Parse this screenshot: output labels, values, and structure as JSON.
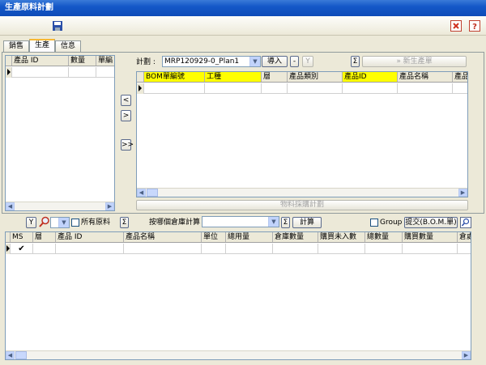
{
  "window": {
    "title": "生產原料計劃"
  },
  "tabs": [
    {
      "label": "銷售"
    },
    {
      "label": "生產"
    },
    {
      "label": "信息"
    }
  ],
  "left_grid": {
    "columns": [
      "產品 ID",
      "數量",
      "單編"
    ]
  },
  "plan": {
    "label": "計劃 :",
    "value": "MRP120929-0_Plan1",
    "import_label": "導入",
    "minus_label": "-",
    "filter_icon_label": "Y",
    "sigma_label": "Σ",
    "new_order_label": "» 新生產單"
  },
  "move_buttons": {
    "left": "<",
    "right": ">",
    "all": ">>"
  },
  "bom_grid": {
    "columns": [
      "BOM單編號",
      "工種",
      "層",
      "產品類別",
      "產品ID",
      "產品名稱",
      "產品"
    ]
  },
  "material_plan_label": "物料採購計劃",
  "controls": {
    "filter_label": "Y",
    "all_materials_label": "所有原料",
    "sigma_label": "Σ",
    "warehouse_label": "按哪個倉庫計算",
    "warehouse_value": "",
    "calculate_label": "計算",
    "group_label": "Group",
    "submit_label": "提交(B.O.M.單)"
  },
  "bottom_grid": {
    "columns": [
      "MS",
      "層",
      "產品 ID",
      "產品名稱",
      "單位",
      "總用量",
      "倉庫數量",
      "購買未入數",
      "總數量",
      "購買數量",
      "倉處"
    ],
    "rows": [
      {
        "ms": "✔"
      }
    ]
  },
  "colors": {
    "title_bar": "#1458c8",
    "header_highlight": "#ffff00",
    "panel": "#ece9d8"
  }
}
